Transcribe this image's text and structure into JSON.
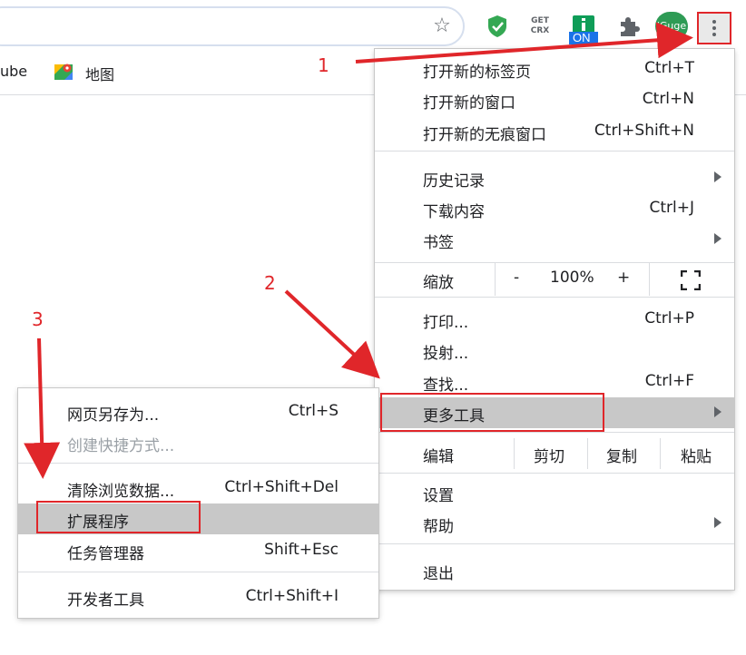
{
  "toolbar": {
    "bookmark_star_icon": "star-outline-icon",
    "extensions": [
      {
        "icon": "shield-check-icon",
        "color": "#34a853"
      },
      {
        "icon": "get-crx-icon",
        "text_line1": "GET",
        "text_line2": "CRX"
      },
      {
        "icon": "info-on-icon",
        "badge": "ON",
        "color": "#1a73e8"
      },
      {
        "icon": "puzzle-icon"
      },
      {
        "icon": "iguge-icon",
        "text": "iGuge",
        "color": "#2e9b55"
      }
    ],
    "menu_icon": "more-vert-icon"
  },
  "bookmarks": {
    "items": [
      {
        "label": "ube"
      },
      {
        "label": "地图",
        "icon": "maps-icon"
      }
    ]
  },
  "menu": {
    "new_tab": {
      "label": "打开新的标签页",
      "shortcut": "Ctrl+T"
    },
    "new_window": {
      "label": "打开新的窗口",
      "shortcut": "Ctrl+N"
    },
    "new_incognito": {
      "label": "打开新的无痕窗口",
      "shortcut": "Ctrl+Shift+N"
    },
    "history": {
      "label": "历史记录"
    },
    "downloads": {
      "label": "下载内容",
      "shortcut": "Ctrl+J"
    },
    "bookmarks": {
      "label": "书签"
    },
    "zoom": {
      "label": "缩放",
      "minus": "-",
      "value": "100%",
      "plus": "+",
      "fullscreen_icon": "fullscreen-icon"
    },
    "print": {
      "label": "打印...",
      "shortcut": "Ctrl+P"
    },
    "cast": {
      "label": "投射..."
    },
    "find": {
      "label": "查找...",
      "shortcut": "Ctrl+F"
    },
    "more_tools": {
      "label": "更多工具"
    },
    "edit": {
      "label": "编辑",
      "cut": "剪切",
      "copy": "复制",
      "paste": "粘贴"
    },
    "settings": {
      "label": "设置"
    },
    "help": {
      "label": "帮助"
    },
    "exit": {
      "label": "退出"
    }
  },
  "submenu": {
    "save_page": {
      "label": "网页另存为...",
      "shortcut": "Ctrl+S"
    },
    "create_shortcut": {
      "label": "创建快捷方式..."
    },
    "clear_data": {
      "label": "清除浏览数据...",
      "shortcut": "Ctrl+Shift+Del"
    },
    "extensions": {
      "label": "扩展程序"
    },
    "task_manager": {
      "label": "任务管理器",
      "shortcut": "Shift+Esc"
    },
    "dev_tools": {
      "label": "开发者工具",
      "shortcut": "Ctrl+Shift+I"
    }
  },
  "annotations": {
    "step1": "1",
    "step2": "2",
    "step3": "3",
    "color": "#e0262a"
  }
}
